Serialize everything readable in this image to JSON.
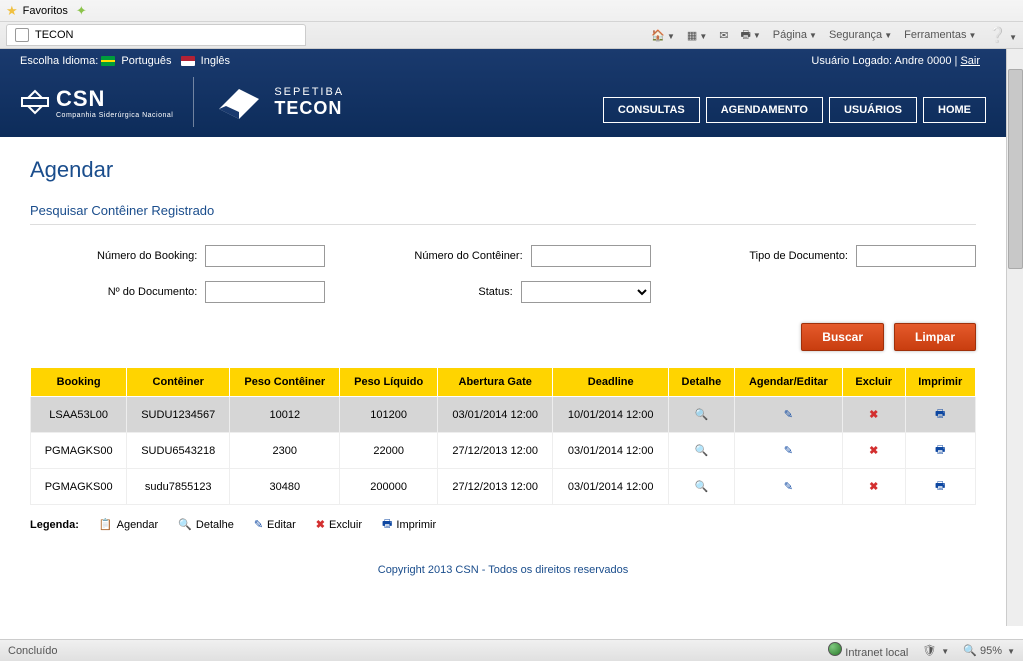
{
  "browser": {
    "favoritos": "Favoritos",
    "tab_title": "TECON",
    "menu_pagina": "Página",
    "menu_seguranca": "Segurança",
    "menu_ferramentas": "Ferramentas"
  },
  "header": {
    "lang_label": "Escolha Idioma:",
    "lang_pt": "Português",
    "lang_en": "Inglês",
    "user_label": "Usuário Logado: Andre 0000",
    "logout": "Sair",
    "logo_csn": "CSN",
    "logo_csn_sub": "Companhia Siderúrgica Nacional",
    "logo_sep": "SEPETIBA",
    "logo_tecon": "TECON"
  },
  "nav": {
    "consultas": "CONSULTAS",
    "agendamento": "AGENDAMENTO",
    "usuarios": "USUÁRIOS",
    "home": "HOME"
  },
  "page": {
    "title": "Agendar",
    "subtitle": "Pesquisar Contêiner Registrado",
    "lbl_booking": "Número do Booking:",
    "lbl_container": "Número do Contêiner:",
    "lbl_doc_type": "Tipo de Documento:",
    "lbl_doc_num": "Nº do Documento:",
    "lbl_status": "Status:",
    "btn_buscar": "Buscar",
    "btn_limpar": "Limpar"
  },
  "table": {
    "headers": {
      "booking": "Booking",
      "conteiner": "Contêiner",
      "peso_cont": "Peso Contêiner",
      "peso_liq": "Peso Líquido",
      "abertura": "Abertura Gate",
      "deadline": "Deadline",
      "detalhe": "Detalhe",
      "agendar": "Agendar/Editar",
      "excluir": "Excluir",
      "imprimir": "Imprimir"
    },
    "rows": [
      {
        "booking": "LSAA53L00",
        "conteiner": "SUDU1234567",
        "peso_cont": "10012",
        "peso_liq": "101200",
        "abertura": "03/01/2014 12:00",
        "deadline": "10/01/2014 12:00"
      },
      {
        "booking": "PGMAGKS00",
        "conteiner": "SUDU6543218",
        "peso_cont": "2300",
        "peso_liq": "22000",
        "abertura": "27/12/2013 12:00",
        "deadline": "03/01/2014 12:00"
      },
      {
        "booking": "PGMAGKS00",
        "conteiner": "sudu7855123",
        "peso_cont": "30480",
        "peso_liq": "200000",
        "abertura": "27/12/2013 12:00",
        "deadline": "03/01/2014 12:00"
      }
    ]
  },
  "legend": {
    "label": "Legenda:",
    "agendar": "Agendar",
    "detalhe": "Detalhe",
    "editar": "Editar",
    "excluir": "Excluir",
    "imprimir": "Imprimir"
  },
  "footer": {
    "copyright": "Copyright 2013 CSN - Todos os direitos reservados"
  },
  "status": {
    "concluido": "Concluído",
    "intranet": "Intranet local",
    "zoom": "95%"
  }
}
